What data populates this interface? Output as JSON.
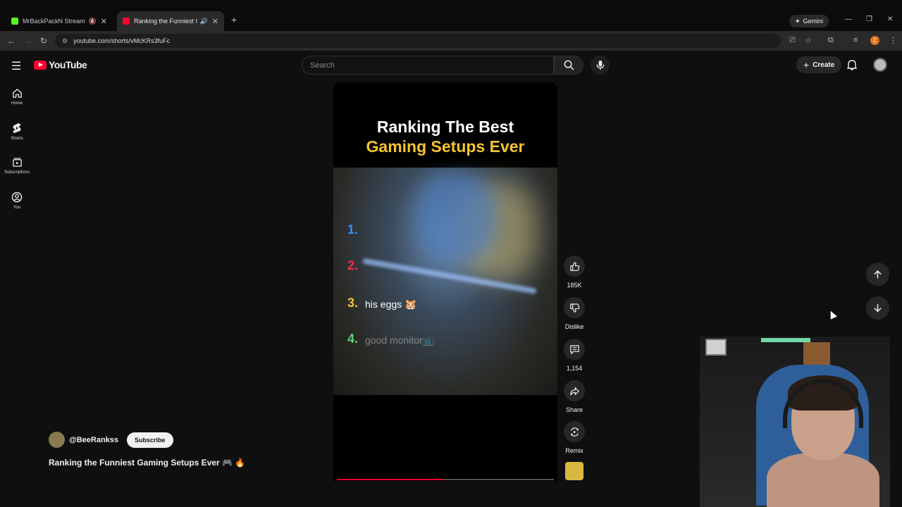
{
  "browser": {
    "tabs": [
      {
        "title": "MrBackPackN Stream - Wa",
        "active": false,
        "favicon_color": "#53fc18"
      },
      {
        "title": "Ranking the Funniest Gami",
        "active": true,
        "favicon_color": "#ff0033"
      }
    ],
    "gemini_label": "Gemini",
    "url": "youtube.com/shorts/vMcKRs3fuFc",
    "profile_initial": "Z"
  },
  "youtube": {
    "logo_text": "YouTube",
    "search_placeholder": "Search",
    "create_label": "Create",
    "sidebar": [
      {
        "label": "Home",
        "icon": "home-icon"
      },
      {
        "label": "Shorts",
        "icon": "shorts-icon"
      },
      {
        "label": "Subscriptions",
        "icon": "subscriptions-icon"
      },
      {
        "label": "You",
        "icon": "you-icon"
      }
    ]
  },
  "short": {
    "title_line1": "Ranking The Best",
    "title_line2": "Gaming Setups Ever",
    "ranks": [
      {
        "num": "1.",
        "text": "",
        "color": "#3a8cf0"
      },
      {
        "num": "2.",
        "text": "",
        "color": "#ff2a4a"
      },
      {
        "num": "3.",
        "text": "his eggs 🐹",
        "color": "#f5c430"
      },
      {
        "num": "4.",
        "text": "good monitor📺",
        "color": "#5fd07a"
      }
    ],
    "progress_fraction": 0.49,
    "actions": {
      "like": "185K",
      "dislike": "Dislike",
      "comments": "1,154",
      "share": "Share",
      "remix": "Remix"
    },
    "channel": "@BeeRankss",
    "subscribe_label": "Subscribe",
    "description": "Ranking the Funniest Gaming Setups Ever 🎮 🔥"
  }
}
